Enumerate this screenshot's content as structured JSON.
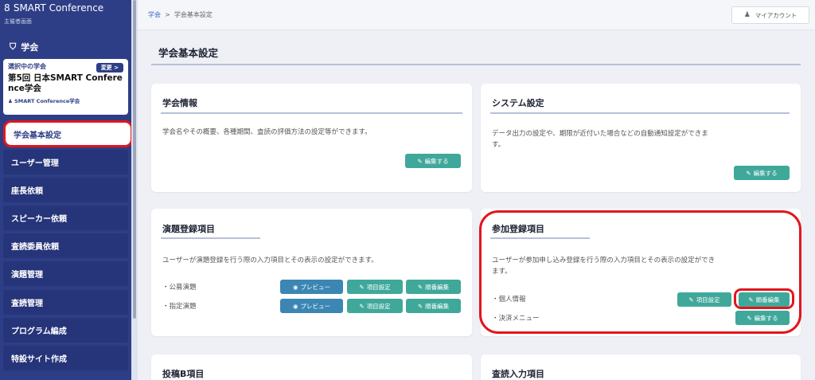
{
  "sidebar": {
    "brand": "SMART Conference",
    "brand_sub": "主催者画面",
    "section_title": "学会",
    "selected": {
      "label": "選択中の学会",
      "change": "変更 >",
      "name_line1": "第5回 日本SMART Confere",
      "name_line2": "nce学会",
      "org": "SMART Conference学会"
    },
    "items": [
      {
        "label": "学会基本設定"
      },
      {
        "label": "ユーザー管理"
      },
      {
        "label": "座長依頼"
      },
      {
        "label": "スピーカー依頼"
      },
      {
        "label": "査読委員依頼"
      },
      {
        "label": "演題管理"
      },
      {
        "label": "査読管理"
      },
      {
        "label": "プログラム編成"
      },
      {
        "label": "特設サイト作成"
      }
    ]
  },
  "topbar": {
    "crumb_home": "学会",
    "crumb_sep": ">",
    "crumb_current": "学会基本設定",
    "account": "マイアカウント"
  },
  "page_title": "学会基本設定",
  "panels": {
    "info": {
      "title": "学会情報",
      "desc": "学会名やその概要、各種期間、査読の評価方法の設定等ができます。",
      "edit": "編集する"
    },
    "system": {
      "title": "システム設定",
      "desc1": "データ出力の設定や、期限が近付いた場合などの自動通知設定ができま",
      "desc2": "す。",
      "edit": "編集する"
    },
    "abstract": {
      "title": "演題登録項目",
      "desc": "ユーザーが演題登録を行う際の入力項目とその表示の設定ができます。",
      "rows": [
        {
          "label": "・公募演題",
          "preview": "プレビュー",
          "item": "項目設定",
          "order": "順番編集"
        },
        {
          "label": "・指定演題",
          "preview": "プレビュー",
          "item": "項目設定",
          "order": "順番編集"
        }
      ]
    },
    "registration": {
      "title": "参加登録項目",
      "desc1": "ユーザーが参加申し込み登録を行う際の入力項目とその表示の設定ができ",
      "desc2": "ます。",
      "rows": [
        {
          "label": "・個人情報",
          "item": "項目設定",
          "order": "順番編集"
        },
        {
          "label": "・決済メニュー",
          "edit": "編集する"
        }
      ]
    },
    "postb": {
      "title": "投稿B項目"
    },
    "review": {
      "title": "査読入力項目"
    }
  },
  "colors": {
    "sidebar": "#2d3e86",
    "accent_button": "#3fa89a",
    "preview_button": "#3b86b3",
    "highlight": "#e3151d"
  }
}
